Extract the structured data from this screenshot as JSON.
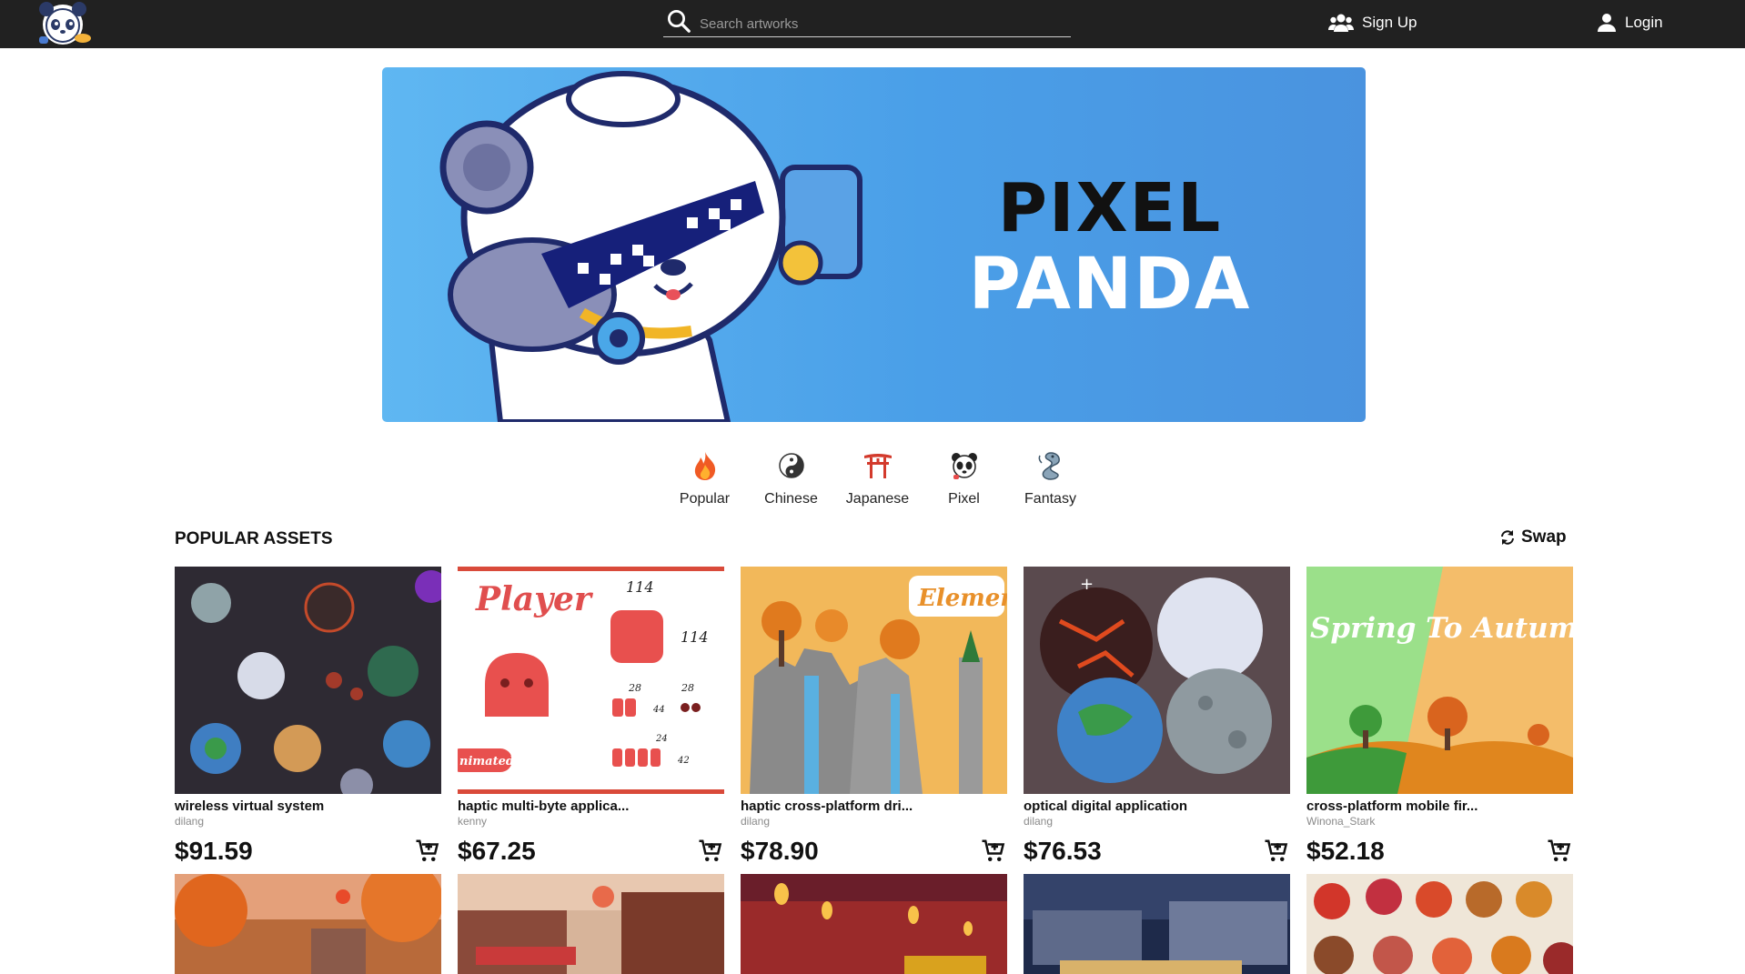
{
  "header": {
    "search_placeholder": "Search artworks",
    "signup_label": "Sign Up",
    "login_label": "Login"
  },
  "banner": {
    "line1": "PIXEL",
    "line2": "PANDA"
  },
  "categories": [
    {
      "label": "Popular",
      "icon": "fire-icon"
    },
    {
      "label": "Chinese",
      "icon": "yin-yang-icon"
    },
    {
      "label": "Japanese",
      "icon": "torii-gate-icon"
    },
    {
      "label": "Pixel",
      "icon": "panda-icon"
    },
    {
      "label": "Fantasy",
      "icon": "dragon-icon"
    }
  ],
  "section": {
    "title": "POPULAR ASSETS",
    "swap_label": "Swap"
  },
  "assets": [
    {
      "name": "wireless virtual system",
      "author": "dilang",
      "price": "$91.59"
    },
    {
      "name": "haptic multi-byte applica...",
      "author": "kenny",
      "price": "$67.25"
    },
    {
      "name": "haptic cross-platform dri...",
      "author": "dilang",
      "price": "$78.90"
    },
    {
      "name": "optical digital application",
      "author": "dilang",
      "price": "$76.53"
    },
    {
      "name": "cross-platform mobile fir...",
      "author": "Winona_Stark",
      "price": "$52.18"
    }
  ],
  "thumb_text": {
    "player_title": "Player",
    "player_dim_w": "114",
    "player_dim_h": "114",
    "player_small_a": "28",
    "player_small_b": "28",
    "player_small_c": "44",
    "player_small_d": "24",
    "player_small_e": "42",
    "player_tag": "nimated",
    "element_tag": "Element",
    "season_title": "Spring To Autumn"
  },
  "colors": {
    "topbar": "#212121",
    "banner_blue": "#4a9fe8",
    "accent_red": "#e84c4c"
  }
}
